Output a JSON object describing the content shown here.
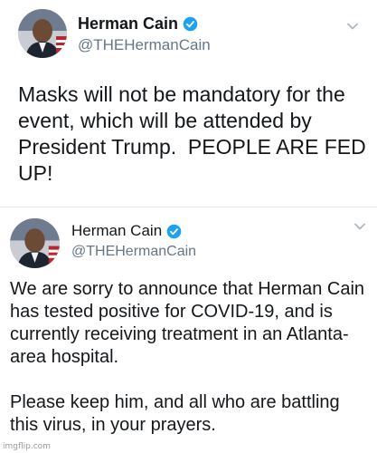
{
  "tweets": [
    {
      "display_name": "Herman Cain",
      "handle": "@THEHermanCain",
      "text": "Masks will not be mandatory for the event, which will be attended by President Trump.  PEOPLE ARE FED UP!",
      "avatar_icon": "avatar-photo",
      "verified_icon": "verified-badge-icon",
      "menu_icon": "chevron-down-icon"
    },
    {
      "display_name": "Herman Cain",
      "handle": "@THEHermanCain",
      "text": "We are sorry to announce that Herman Cain has tested positive for COVID-19, and is currently receiving treatment in an Atlanta-area hospital.\n\nPlease keep him, and all who are battling this virus, in your prayers.",
      "avatar_icon": "avatar-photo",
      "verified_icon": "verified-badge-icon",
      "menu_icon": "chevron-down-icon"
    }
  ],
  "watermark": "imgflip.com",
  "colors": {
    "verified_blue": "#1da1f2",
    "handle_gray": "#657786",
    "text": "#14171a",
    "chevron_gray": "#aab8c2"
  }
}
